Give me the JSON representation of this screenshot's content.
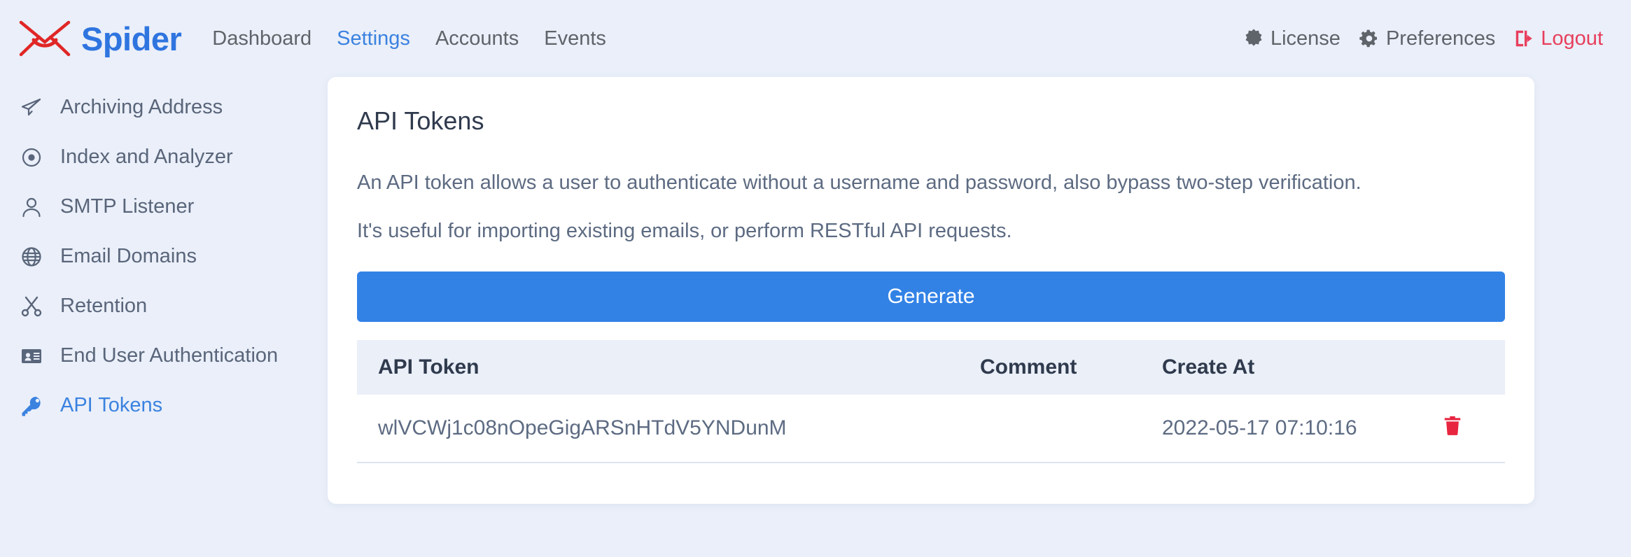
{
  "header": {
    "brand": {
      "name": "Spider",
      "logo_icon": "envelope-x-logo-icon",
      "color": "#2f75e0"
    },
    "nav": [
      {
        "label": "Dashboard",
        "active": false
      },
      {
        "label": "Settings",
        "active": true
      },
      {
        "label": "Accounts",
        "active": false
      },
      {
        "label": "Events",
        "active": false
      }
    ],
    "right_nav": [
      {
        "label": "License",
        "icon": "certificate-icon",
        "danger": false
      },
      {
        "label": "Preferences",
        "icon": "gear-icon",
        "danger": false
      },
      {
        "label": "Logout",
        "icon": "sign-out-icon",
        "danger": true
      }
    ]
  },
  "sidebar": {
    "items": [
      {
        "label": "Archiving Address",
        "icon": "paper-plane-icon",
        "active": false
      },
      {
        "label": "Index and Analyzer",
        "icon": "bullseye-icon",
        "active": false
      },
      {
        "label": "SMTP Listener",
        "icon": "user-icon",
        "active": false
      },
      {
        "label": "Email Domains",
        "icon": "globe-icon",
        "active": false
      },
      {
        "label": "Retention",
        "icon": "scissors-icon",
        "active": false
      },
      {
        "label": "End User Authentication",
        "icon": "id-card-icon",
        "active": false
      },
      {
        "label": "API Tokens",
        "icon": "key-icon",
        "active": true
      }
    ]
  },
  "main": {
    "title": "API Tokens",
    "paragraph1": "An API token allows a user to authenticate without a username and password, also bypass two-step verification.",
    "paragraph2": "It's useful for importing existing emails, or perform RESTful API requests.",
    "generate_label": "Generate",
    "table": {
      "columns": [
        "API Token",
        "Comment",
        "Create At",
        ""
      ],
      "rows": [
        {
          "token": "wlVCWj1c08nOpeGigARSnHTdV5YNDunM",
          "comment": "",
          "created_at": "2022-05-17 07:10:16",
          "delete_icon": "trash-icon"
        }
      ]
    }
  },
  "colors": {
    "page_background": "#eaeff9",
    "accent_blue": "#3282e6",
    "danger_red": "#e83e5c",
    "text_muted": "#5d6b82"
  }
}
